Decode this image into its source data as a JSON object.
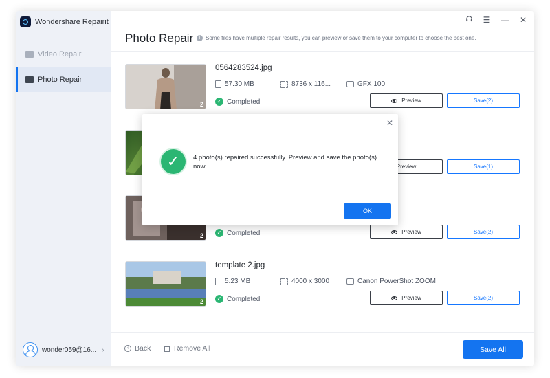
{
  "app": {
    "title": "Wondershare Repairit"
  },
  "sidebar": {
    "items": [
      {
        "label": "Video Repair",
        "active": false
      },
      {
        "label": "Photo Repair",
        "active": true
      }
    ],
    "user": {
      "name": "wonder059@16...",
      "chevron": "›"
    }
  },
  "window_controls": {
    "support_icon": "headset-icon",
    "menu": "☰",
    "minimize": "—",
    "close": "✕"
  },
  "header": {
    "title": "Photo Repair",
    "info_icon": "i",
    "subtitle": "Some files have multiple repair results, you can preview or save them to your computer to choose the best one."
  },
  "files": [
    {
      "name": "0564283524.jpg",
      "size": "57.30 MB",
      "resolution": "8736 x 116...",
      "camera": "GFX 100",
      "status": "Completed",
      "count": "2",
      "preview": "Preview",
      "save": "Save(2)"
    },
    {
      "name": "",
      "size": "",
      "resolution": "",
      "camera": "",
      "status": "",
      "count": "",
      "preview": "Preview",
      "save": "Save(1)"
    },
    {
      "name": "",
      "size": "",
      "resolution": "",
      "camera": "",
      "status": "Completed",
      "count": "2",
      "preview": "Preview",
      "save": "Save(2)"
    },
    {
      "name": "template 2.jpg",
      "size": "5.23 MB",
      "resolution": "4000 x 3000",
      "camera": "Canon PowerShot ZOOM",
      "status": "Completed",
      "count": "2",
      "preview": "Preview",
      "save": "Save(2)"
    }
  ],
  "footer": {
    "back": "Back",
    "back_icon": "‹",
    "remove_all": "Remove All",
    "save_all": "Save All"
  },
  "dialog": {
    "close": "✕",
    "check": "✓",
    "message": "4 photo(s) repaired successfully. Preview and save the photo(s) now.",
    "ok": "OK"
  },
  "colors": {
    "accent": "#1474f0",
    "success": "#2bb673",
    "sidebar_bg": "#eef1f7"
  }
}
